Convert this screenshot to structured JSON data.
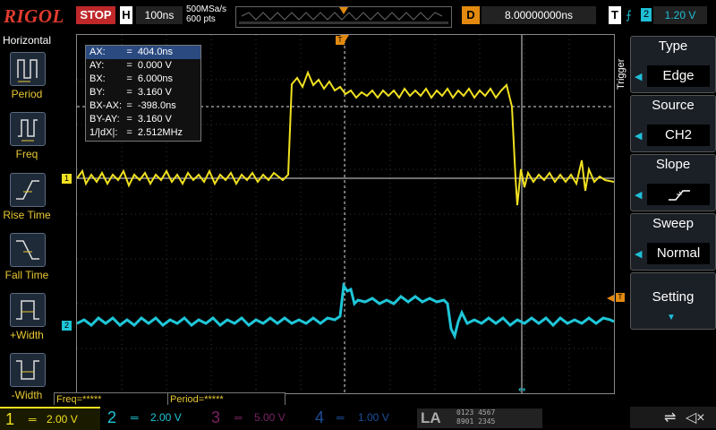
{
  "topbar": {
    "logo": "RIGOL",
    "run_state": "STOP",
    "horizontal_label": "H",
    "timebase": "100ns",
    "sample_rate": "500MSa/s",
    "memory_depth": "600 pts",
    "delay_label": "D",
    "delay_value": "8.00000000ns",
    "trigger_label": "T",
    "trigger_source": "2",
    "trigger_level": "1.20 V"
  },
  "left_panel": {
    "title": "Horizontal",
    "items": [
      {
        "label": "Period",
        "icon": "period-icon"
      },
      {
        "label": "Freq",
        "icon": "freq-icon"
      },
      {
        "label": "Rise Time",
        "icon": "rise-time-icon"
      },
      {
        "label": "Fall Time",
        "icon": "fall-time-icon"
      },
      {
        "label": "+Width",
        "icon": "positive-width-icon"
      },
      {
        "label": "-Width",
        "icon": "negative-width-icon"
      }
    ]
  },
  "measurements": [
    {
      "key": "AX:",
      "value": "404.0ns"
    },
    {
      "key": "AY:",
      "value": "0.000 V"
    },
    {
      "key": "BX:",
      "value": "6.000ns"
    },
    {
      "key": "BY:",
      "value": "3.160 V"
    },
    {
      "key": "BX-AX:",
      "value": "-398.0ns"
    },
    {
      "key": "BY-AY:",
      "value": "3.160 V"
    },
    {
      "key": "1/|dX|:",
      "value": "2.512MHz"
    }
  ],
  "measure_eq": "=",
  "freq_readout": "Freq=*****",
  "period_readout": "Period=*****",
  "right_panel": {
    "title": "Trigger",
    "menus": [
      {
        "label": "Type",
        "value": "Edge"
      },
      {
        "label": "Source",
        "value": "CH2"
      },
      {
        "label": "Slope",
        "value": ""
      },
      {
        "label": "Sweep",
        "value": "Normal"
      },
      {
        "label": "Setting",
        "value": ""
      }
    ]
  },
  "channels": [
    {
      "num": "1",
      "scale": "2.00 V",
      "color": "#f0e020"
    },
    {
      "num": "2",
      "scale": "2.00 V",
      "color": "#1fc6d8"
    },
    {
      "num": "3",
      "scale": "5.00 V",
      "color": "#c0309c"
    },
    {
      "num": "4",
      "scale": "1.00 V",
      "color": "#2266cc"
    }
  ],
  "la_label": "LA",
  "la_digits_top": "0123 4567",
  "la_digits_bottom": "8901 2345",
  "colors": {
    "ch1": "#f0e020",
    "ch2": "#1fc6d8",
    "trigger": "#e28a10",
    "stop": "#c0282a"
  }
}
